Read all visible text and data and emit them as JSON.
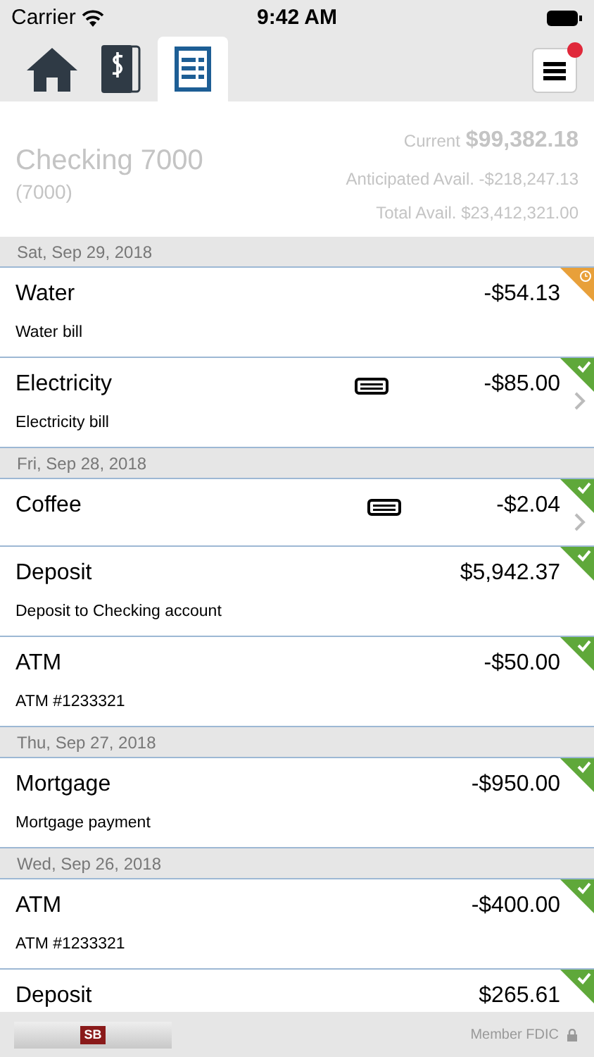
{
  "status_bar": {
    "carrier": "Carrier",
    "time": "9:42 AM"
  },
  "tabs": [
    {
      "kind": "home",
      "selected": false
    },
    {
      "kind": "money",
      "selected": false
    },
    {
      "kind": "statement",
      "selected": true
    }
  ],
  "menu": {
    "notification": true
  },
  "account": {
    "name": "Checking 7000",
    "number": "(7000)",
    "current_label": "Current",
    "current": "$99,382.18",
    "anticipated": "Anticipated Avail. -$218,247.13",
    "total": "Total Avail. $23,412,321.00"
  },
  "days": [
    {
      "date": "Sat, Sep 29, 2018",
      "transactions": [
        {
          "name": "Water",
          "description": "Water bill",
          "amount": "-$54.13",
          "cleared": false,
          "memo": false,
          "detail": false
        },
        {
          "name": "Electricity",
          "description": "Electricity bill",
          "amount": "-$85.00",
          "cleared": true,
          "memo": true,
          "detail": true
        }
      ]
    },
    {
      "date": "Fri, Sep 28, 2018",
      "transactions": [
        {
          "name": "Coffee",
          "amount": "-$2.04",
          "cleared": true,
          "memo": true,
          "detail": true
        },
        {
          "name": "Deposit",
          "description": "Deposit to Checking account",
          "amount": "$5,942.37",
          "cleared": true,
          "memo": false,
          "detail": false
        },
        {
          "name": "ATM",
          "description": "ATM #1233321",
          "amount": "-$50.00",
          "cleared": true,
          "memo": false,
          "detail": false
        }
      ]
    },
    {
      "date": "Thu, Sep 27, 2018",
      "transactions": [
        {
          "name": "Mortgage",
          "description": "Mortgage payment",
          "amount": "-$950.00",
          "cleared": true,
          "memo": false,
          "detail": false
        }
      ]
    },
    {
      "date": "Wed, Sep 26, 2018",
      "transactions": [
        {
          "name": "ATM",
          "description": "ATM #1233321",
          "amount": "-$400.00",
          "cleared": true,
          "memo": false,
          "detail": false
        },
        {
          "name": "Deposit",
          "amount": "$265.61",
          "cleared": true,
          "memo": false,
          "detail": false
        }
      ]
    }
  ],
  "footer": {
    "logo_text": "SB",
    "note": "Member FDIC"
  }
}
